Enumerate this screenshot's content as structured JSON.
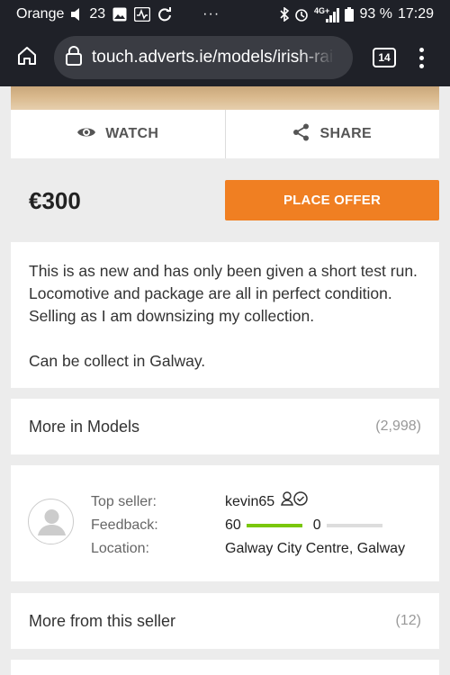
{
  "status_bar": {
    "carrier": "Orange",
    "notif_count": "23",
    "dots": "···",
    "battery": "93 %",
    "time": "17:29",
    "icons": [
      "volume-icon",
      "image-icon",
      "activity-icon",
      "sync-icon",
      "bluetooth-icon",
      "alarm-icon",
      "signal-4g-icon",
      "battery-icon"
    ]
  },
  "browser": {
    "url": "touch.adverts.ie/models/irish-railway",
    "tab_count": "14",
    "icons": [
      "home-icon",
      "lock-icon",
      "tabs-icon",
      "menu-icon"
    ]
  },
  "actions": {
    "watch_label": "WATCH",
    "share_label": "SHARE"
  },
  "listing": {
    "price": "€300",
    "offer_label": "PLACE OFFER",
    "description": [
      "This is as new and has only been given a short test run. Locomotive and package are all in perfect condition. Selling as I am downsizing my collection.",
      "Can be collect in Galway."
    ]
  },
  "more_in_models": {
    "label": "More in Models",
    "count": "(2,998)"
  },
  "seller": {
    "top_seller_label": "Top seller:",
    "feedback_label": "Feedback:",
    "location_label": "Location:",
    "name": "kevin65",
    "feedback_positive": "60",
    "feedback_negative": "0",
    "feedback_positive_fraction": 1.0,
    "location": "Galway City Centre, Galway"
  },
  "more_from_seller": {
    "label": "More from this seller",
    "count": "(12)"
  },
  "colors": {
    "accent": "#f07f22",
    "positive_bar": "#7ac70c",
    "negative_bar": "#dddddd",
    "topbar": "#1f2128"
  }
}
